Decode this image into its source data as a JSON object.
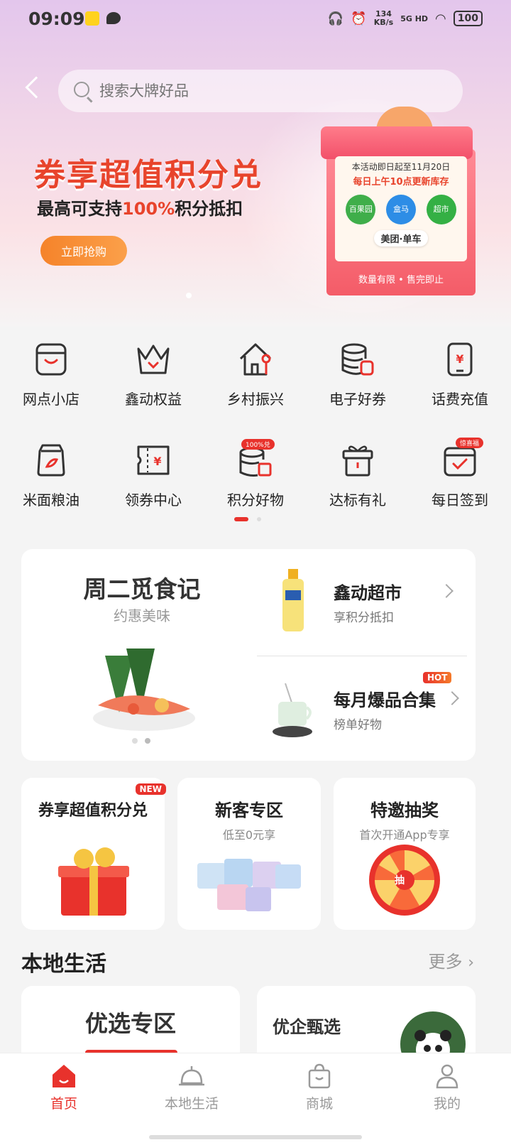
{
  "status_bar": {
    "time": "09:09",
    "speed": "134",
    "speed_unit": "KB/s",
    "network": "5G HD",
    "battery": "100"
  },
  "search": {
    "placeholder": "搜索大牌好品"
  },
  "banner": {
    "title": "券享超值积分兑",
    "subtitle_prefix": "最高可支持",
    "subtitle_highlight": "100%",
    "subtitle_suffix": "积分抵扣",
    "button": "立即抢购",
    "gift_line1": "本活动即日起至11月20日",
    "gift_line2": "每日上午10点更新库存",
    "logo1": "百果园",
    "logo2": "盒马",
    "logo3": "超市",
    "meituan": "美团·单车",
    "gift_footer": "数量有限 • 售完即止"
  },
  "menu_row1": [
    {
      "label": "网点小店",
      "icon": "shop-icon"
    },
    {
      "label": "鑫动权益",
      "icon": "crown-icon"
    },
    {
      "label": "乡村振兴",
      "icon": "house-icon"
    },
    {
      "label": "电子好券",
      "icon": "coupon-stack-icon"
    },
    {
      "label": "话费充值",
      "icon": "phone-icon"
    }
  ],
  "menu_row2": [
    {
      "label": "米面粮油",
      "icon": "rice-bag-icon"
    },
    {
      "label": "领券中心",
      "icon": "ticket-icon",
      "symbol": "¥"
    },
    {
      "label": "积分好物",
      "icon": "points-icon",
      "tag": "100%兑"
    },
    {
      "label": "达标有礼",
      "icon": "gift-icon"
    },
    {
      "label": "每日签到",
      "icon": "calendar-check-icon",
      "tag": "惊喜福"
    }
  ],
  "feature": {
    "title": "周二觅食记",
    "subtitle": "约惠美味",
    "item1_title": "鑫动超市",
    "item1_sub": "享积分抵扣",
    "item2_title": "每月爆品合集",
    "item2_sub": "榜单好物",
    "hot_tag": "HOT"
  },
  "promos": [
    {
      "title": "券享超值积分兑",
      "sub": "",
      "tag": "NEW"
    },
    {
      "title": "新客专区",
      "sub": "低至0元享"
    },
    {
      "title": "特邀抽奖",
      "sub": "首次开通App专享",
      "wheel": "抽"
    }
  ],
  "local": {
    "title": "本地生活",
    "more": "更多",
    "card1": "优选专区",
    "card2": "优企甄选"
  },
  "tabs": [
    {
      "label": "首页",
      "icon": "home-icon"
    },
    {
      "label": "本地生活",
      "icon": "service-bell-icon"
    },
    {
      "label": "商城",
      "icon": "shopping-bag-icon"
    },
    {
      "label": "我的",
      "icon": "user-icon"
    }
  ],
  "colors": {
    "accent": "#e8322c",
    "orange": "#f5832a"
  }
}
